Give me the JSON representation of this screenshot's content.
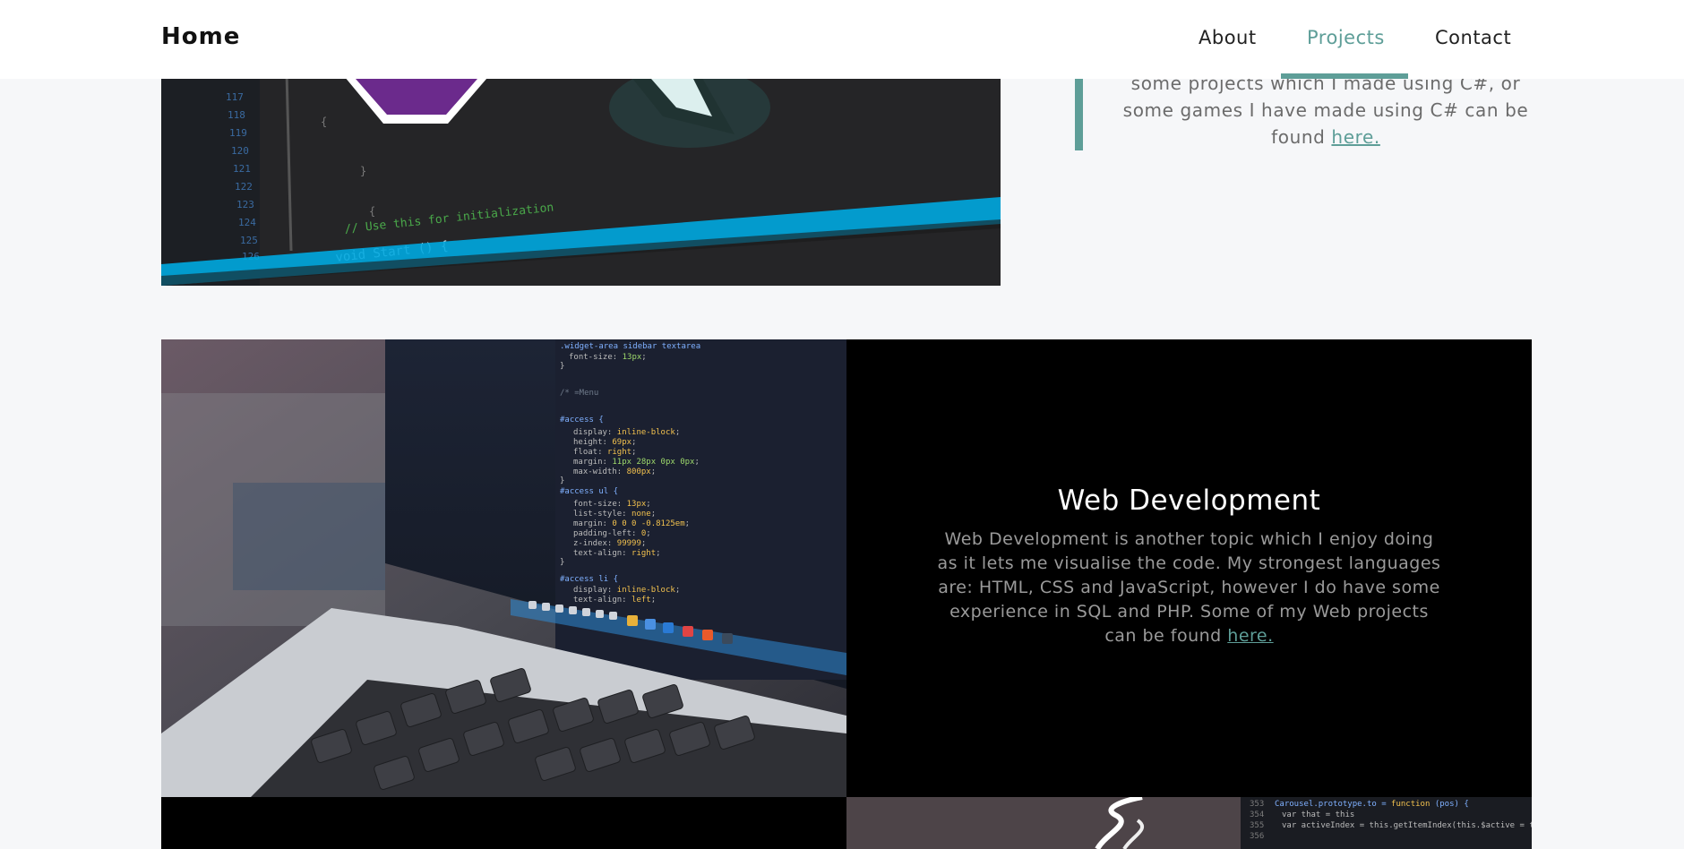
{
  "nav": {
    "brand": "Home",
    "items": [
      "About",
      "Projects",
      "Contact"
    ],
    "active_item": "Projects"
  },
  "top_section": {
    "text_line_1": "some projects which I made using C#, or",
    "text_line_2": "some games I have made using C# can be",
    "text_prefix": "found ",
    "link_label": "here.",
    "image": "csharp-code-editor-image"
  },
  "web_section": {
    "title": "Web Development",
    "text": "Web Development is another topic which I enjoy doing as it lets me visualise the code. My strongest languages are: HTML, CSS and JavaScript, however I do have some experience in SQL and PHP. Some of my Web projects can be found ",
    "link_label": "here.",
    "image": "laptop-css-code-image"
  },
  "bottom_section": {
    "image": "java-code-image"
  },
  "colors": {
    "accent": "#5e9e98",
    "background": "#f6f7f9",
    "panel": "#000000",
    "text_muted": "#9a9a9a"
  }
}
